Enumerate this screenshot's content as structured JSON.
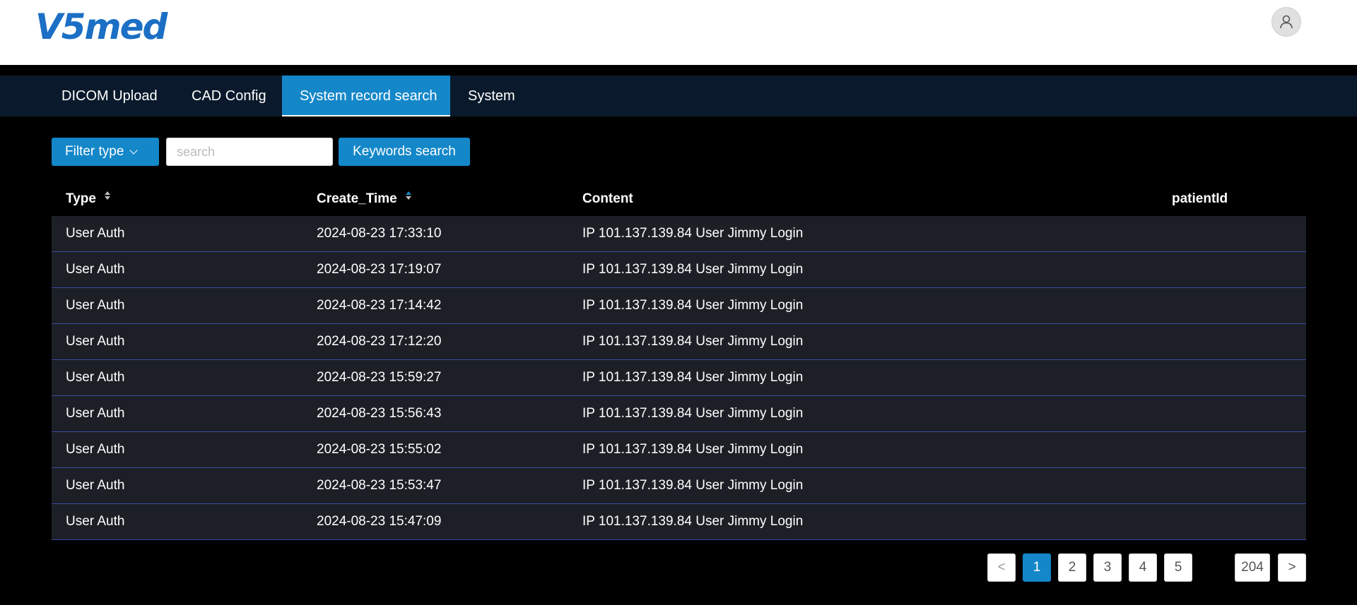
{
  "header": {
    "logo_text": "V5med",
    "avatar_icon": "user-icon"
  },
  "nav": {
    "tabs": [
      {
        "label": "DICOM Upload",
        "active": false
      },
      {
        "label": "CAD Config",
        "active": false
      },
      {
        "label": "System record search",
        "active": true
      },
      {
        "label": "System",
        "active": false
      }
    ]
  },
  "toolbar": {
    "filter_label": "Filter type",
    "search_placeholder": "search",
    "search_value": "",
    "keywords_label": "Keywords search"
  },
  "table": {
    "columns": [
      "Type",
      "Create_Time",
      "Content",
      "patientId"
    ],
    "sort": {
      "column": "Create_Time",
      "direction": "ascending"
    },
    "rows": [
      {
        "type": "User Auth",
        "create_time": "2024-08-23 17:33:10",
        "content": "IP 101.137.139.84 User Jimmy Login",
        "patient_id": ""
      },
      {
        "type": "User Auth",
        "create_time": "2024-08-23 17:19:07",
        "content": "IP 101.137.139.84 User Jimmy Login",
        "patient_id": ""
      },
      {
        "type": "User Auth",
        "create_time": "2024-08-23 17:14:42",
        "content": "IP 101.137.139.84 User Jimmy Login",
        "patient_id": ""
      },
      {
        "type": "User Auth",
        "create_time": "2024-08-23 17:12:20",
        "content": "IP 101.137.139.84 User Jimmy Login",
        "patient_id": ""
      },
      {
        "type": "User Auth",
        "create_time": "2024-08-23 15:59:27",
        "content": "IP 101.137.139.84 User Jimmy Login",
        "patient_id": ""
      },
      {
        "type": "User Auth",
        "create_time": "2024-08-23 15:56:43",
        "content": "IP 101.137.139.84 User Jimmy Login",
        "patient_id": ""
      },
      {
        "type": "User Auth",
        "create_time": "2024-08-23 15:55:02",
        "content": "IP 101.137.139.84 User Jimmy Login",
        "patient_id": ""
      },
      {
        "type": "User Auth",
        "create_time": "2024-08-23 15:53:47",
        "content": "IP 101.137.139.84 User Jimmy Login",
        "patient_id": ""
      },
      {
        "type": "User Auth",
        "create_time": "2024-08-23 15:47:09",
        "content": "IP 101.137.139.84 User Jimmy Login",
        "patient_id": ""
      }
    ]
  },
  "pagination": {
    "prev": "<",
    "pages": [
      "1",
      "2",
      "3",
      "4",
      "5"
    ],
    "current": "1",
    "last": "204",
    "next": ">"
  },
  "colors": {
    "accent": "#1487c9",
    "nav_bg": "#0a1a2c",
    "row_bg": "#1c2026",
    "row_divider": "#3d48a0",
    "logo": "#1b6fc4"
  }
}
